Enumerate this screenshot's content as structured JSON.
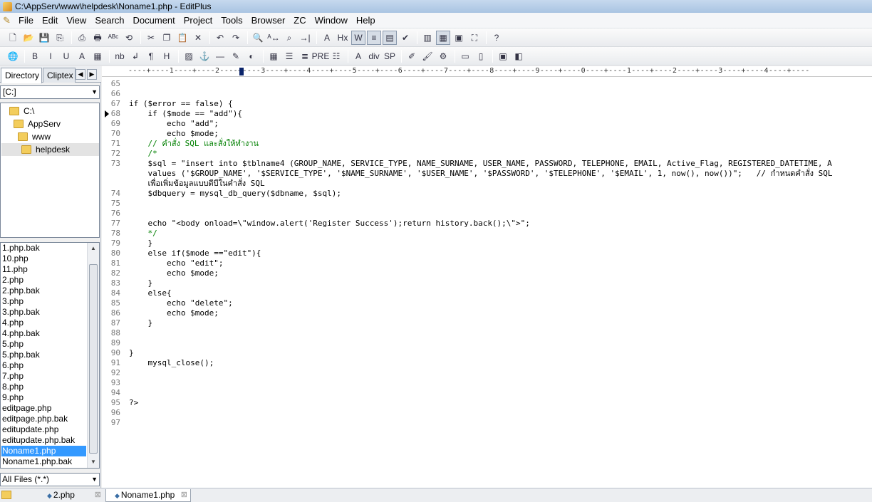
{
  "window": {
    "title": "C:\\AppServ\\www\\helpdesk\\Noname1.php - EditPlus"
  },
  "menu": [
    "File",
    "Edit",
    "View",
    "Search",
    "Document",
    "Project",
    "Tools",
    "Browser",
    "ZC",
    "Window",
    "Help"
  ],
  "toolbar1": [
    {
      "name": "new-file-icon",
      "glyph": "🗋"
    },
    {
      "name": "open-folder-icon",
      "glyph": "📂"
    },
    {
      "name": "save-icon",
      "glyph": "💾"
    },
    {
      "name": "save-all-icon",
      "glyph": "⎘"
    },
    {
      "sep": true
    },
    {
      "name": "print-preview-icon",
      "glyph": "⎙"
    },
    {
      "name": "print-icon",
      "glyph": "🖶"
    },
    {
      "name": "spell-check-icon",
      "glyph": "ᴬᴮᶜ"
    },
    {
      "name": "browser-icon",
      "glyph": "⟲"
    },
    {
      "sep": true
    },
    {
      "name": "cut-icon",
      "glyph": "✂"
    },
    {
      "name": "copy-icon",
      "glyph": "❐"
    },
    {
      "name": "paste-icon",
      "glyph": "📋"
    },
    {
      "name": "delete-icon",
      "glyph": "✕"
    },
    {
      "sep": true
    },
    {
      "name": "undo-icon",
      "glyph": "↶"
    },
    {
      "name": "redo-icon",
      "glyph": "↷"
    },
    {
      "sep": true
    },
    {
      "name": "find-icon",
      "glyph": "🔍"
    },
    {
      "name": "replace-icon",
      "glyph": "ᴬ↔"
    },
    {
      "name": "find-in-files-icon",
      "glyph": "⌕"
    },
    {
      "name": "goto-icon",
      "glyph": "→|"
    },
    {
      "sep": true
    },
    {
      "name": "font-icon",
      "glyph": "A"
    },
    {
      "name": "hex-icon",
      "glyph": "Hx"
    },
    {
      "name": "word-wrap-icon",
      "glyph": "W",
      "pressed": true
    },
    {
      "name": "line-number-icon",
      "glyph": "≡",
      "pressed": true
    },
    {
      "name": "ruler-icon",
      "glyph": "▤",
      "pressed": true
    },
    {
      "name": "check-icon",
      "glyph": "✔"
    },
    {
      "sep": true
    },
    {
      "name": "panel-icon",
      "glyph": "▥"
    },
    {
      "name": "directory-window-icon",
      "glyph": "▦",
      "pressed": true
    },
    {
      "name": "output-window-icon",
      "glyph": "▣"
    },
    {
      "name": "full-screen-icon",
      "glyph": "⛶"
    },
    {
      "sep": true
    },
    {
      "name": "help-icon",
      "glyph": "?"
    }
  ],
  "toolbar2": [
    {
      "name": "globe-icon",
      "glyph": "🌐"
    },
    {
      "sep": true
    },
    {
      "name": "bold-icon",
      "glyph": "B"
    },
    {
      "name": "italic-icon",
      "glyph": "I"
    },
    {
      "name": "underline-icon",
      "glyph": "U"
    },
    {
      "name": "font-color-icon",
      "glyph": "A"
    },
    {
      "name": "color-palette-icon",
      "glyph": "▦"
    },
    {
      "sep": true
    },
    {
      "name": "nbsp-icon",
      "glyph": "nb"
    },
    {
      "name": "line-break-icon",
      "glyph": "↲"
    },
    {
      "name": "paragraph-icon",
      "glyph": "¶"
    },
    {
      "name": "heading-icon",
      "glyph": "H"
    },
    {
      "sep": true
    },
    {
      "name": "image-icon",
      "glyph": "▨"
    },
    {
      "name": "anchor-icon",
      "glyph": "⚓"
    },
    {
      "name": "horizontal-rule-icon",
      "glyph": "—"
    },
    {
      "name": "highlight-icon",
      "glyph": "✎"
    },
    {
      "name": "comment-icon",
      "glyph": "◐"
    },
    {
      "sep": true
    },
    {
      "name": "table-icon",
      "glyph": "▦"
    },
    {
      "name": "align-icon",
      "glyph": "☰"
    },
    {
      "name": "center-icon",
      "glyph": "≣"
    },
    {
      "name": "pre-icon",
      "glyph": "PRE"
    },
    {
      "name": "list-icon",
      "glyph": "☷"
    },
    {
      "sep": true
    },
    {
      "name": "text-box-icon",
      "glyph": "A"
    },
    {
      "name": "div-icon",
      "glyph": "div"
    },
    {
      "name": "span-icon",
      "glyph": "SP"
    },
    {
      "sep": true
    },
    {
      "name": "edit-tag-icon",
      "glyph": "✐"
    },
    {
      "name": "brush-icon",
      "glyph": "🖌"
    },
    {
      "name": "tools-icon",
      "glyph": "⚙"
    },
    {
      "sep": true
    },
    {
      "name": "form-icon",
      "glyph": "▭"
    },
    {
      "name": "input-icon",
      "glyph": "▯"
    },
    {
      "sep": true
    },
    {
      "name": "preview-icon",
      "glyph": "▣"
    },
    {
      "name": "layout-icon",
      "glyph": "◧"
    }
  ],
  "left_panel": {
    "tabs": [
      "Directory",
      "Cliptex"
    ],
    "drive": "[C:]",
    "tree": [
      "C:\\",
      "AppServ",
      "www",
      "helpdesk"
    ],
    "files": [
      "1.php.bak",
      "10.php",
      "11.php",
      "2.php",
      "2.php.bak",
      "3.php",
      "3.php.bak",
      "4.php",
      "4.php.bak",
      "5.php",
      "5.php.bak",
      "6.php",
      "7.php",
      "8.php",
      "9.php",
      "editpage.php",
      "editpage.php.bak",
      "editupdate.php",
      "editupdate.php.bak",
      "Noname1.php",
      "Noname1.php.bak"
    ],
    "selected_file": "Noname1.php",
    "filter": "All Files (*.*)"
  },
  "ruler": "----+----1----+----2----+----3----+----4----+----5----+----6----+----7----+----8----+----9----+----0----+----1----+----2----+----3----+----4----+----",
  "code_lines": [
    {
      "n": "65",
      "t": ""
    },
    {
      "n": "66",
      "t": ""
    },
    {
      "n": "67",
      "t": "if ($error == false) {"
    },
    {
      "n": "68",
      "t": "    if ($mode == \"add\"){"
    },
    {
      "n": "69",
      "t": "        echo \"add\";"
    },
    {
      "n": "70",
      "t": "        echo $mode;"
    },
    {
      "n": "71",
      "t": "    // คำสั่ง SQL และสั่งให้ทำงาน"
    },
    {
      "n": "72",
      "t": "    /*"
    },
    {
      "n": "73",
      "t": "    $sql = \"insert into $tblname4 (GROUP_NAME, SERVICE_TYPE, NAME_SURNAME, USER_NAME, PASSWORD, TELEPHONE, EMAIL, Active_Flag, REGISTERED_DATETIME, A"
    },
    {
      "n": "",
      "t": "    values ('$GROUP_NAME', '$SERVICE_TYPE', '$NAME_SURNAME', '$USER_NAME', '$PASSWORD', '$TELEPHONE', '$EMAIL', 1, now(), now())\";   // กำหนดคำสั่ง SQL"
    },
    {
      "n": "",
      "t": "    เพื่อเพิ่มข้อมูลแบบดีบีในคำสั่ง SQL"
    },
    {
      "n": "74",
      "t": "    $dbquery = mysql_db_query($dbname, $sql);"
    },
    {
      "n": "75",
      "t": ""
    },
    {
      "n": "76",
      "t": ""
    },
    {
      "n": "77",
      "t": "    echo \"<body onload=\\\"window.alert('Register Success');return history.back();\\\">\";"
    },
    {
      "n": "78",
      "t": "    */"
    },
    {
      "n": "79",
      "t": "    }"
    },
    {
      "n": "80",
      "t": "    else if($mode ==\"edit\"){"
    },
    {
      "n": "81",
      "t": "        echo \"edit\";"
    },
    {
      "n": "82",
      "t": "        echo $mode;"
    },
    {
      "n": "83",
      "t": "    }"
    },
    {
      "n": "84",
      "t": "    else{"
    },
    {
      "n": "85",
      "t": "        echo \"delete\";"
    },
    {
      "n": "86",
      "t": "        echo $mode;"
    },
    {
      "n": "87",
      "t": "    }"
    },
    {
      "n": "88",
      "t": ""
    },
    {
      "n": "89",
      "t": ""
    },
    {
      "n": "90",
      "t": "}"
    },
    {
      "n": "91",
      "t": "    mysql_close();"
    },
    {
      "n": "92",
      "t": ""
    },
    {
      "n": "93",
      "t": ""
    },
    {
      "n": "94",
      "t": ""
    },
    {
      "n": "95",
      "t": "?>"
    },
    {
      "n": "96",
      "t": ""
    },
    {
      "n": "97",
      "t": ""
    }
  ],
  "doc_tabs": [
    {
      "label": "2.php",
      "active": false
    },
    {
      "label": "Noname1.php",
      "active": true
    }
  ],
  "close_glyph": "⊠"
}
